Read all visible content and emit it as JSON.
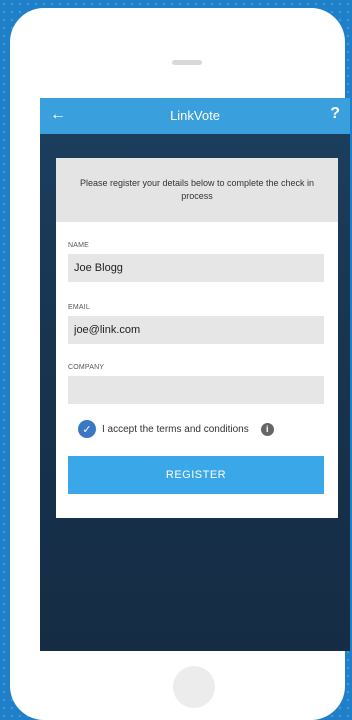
{
  "app": {
    "title": "LinkVote",
    "back_icon": "arrow-left-icon",
    "help_label": "?"
  },
  "form": {
    "intro": "Please register your details below to complete the check in process",
    "name_label": "NAME",
    "name_value": "Joe Blogg",
    "email_label": "EMAIL",
    "email_value": "joe@link.com",
    "company_label": "COMPANY",
    "company_value": "",
    "terms_label": "I accept the terms and conditions",
    "terms_checked": true,
    "info_glyph": "i",
    "register_label": "REGISTER"
  },
  "colors": {
    "background": "#1f80c9",
    "appbar": "#3aa0dd",
    "button": "#3aa7e8",
    "checkbox": "#3b78c4",
    "screen": "#18344f"
  }
}
